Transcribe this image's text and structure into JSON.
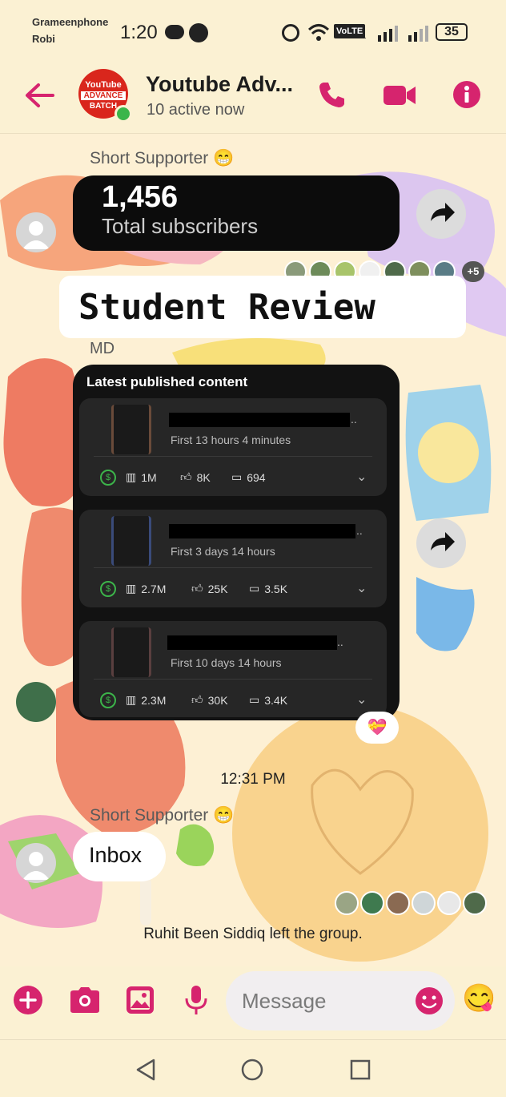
{
  "status_bar": {
    "carrier_1": "Grameenphone",
    "carrier_2": "Robi",
    "time": "1:20",
    "volte": "VoLTE",
    "sim_index": "1",
    "battery": "35"
  },
  "header": {
    "title": "Youtube Adv...",
    "subtitle": "10 active now",
    "logo_line_1": "YouTube",
    "logo_line_2": "ADVANCE",
    "logo_line_3": "BATCH"
  },
  "messages": [
    {
      "sender": "Short Supporter 😁",
      "subscriber_count": "1,456",
      "subscriber_label": "Total subscribers"
    },
    {
      "review_label": "Student Review"
    },
    {
      "sender": "MD",
      "panel_title": "Latest published content",
      "videos": [
        {
          "caption": "First 13 hours 4 minutes",
          "views": "1M",
          "likes": "8K",
          "comments": "694",
          "title_ellipsis": ".."
        },
        {
          "caption": "First 3 days 14 hours",
          "views": "2.7M",
          "likes": "25K",
          "comments": "3.5K",
          "title_ellipsis": ".."
        },
        {
          "caption": "First 10 days 14 hours",
          "views": "2.3M",
          "likes": "30K",
          "comments": "3.4K",
          "title_ellipsis": ".."
        }
      ],
      "reaction": "💝"
    },
    {
      "timestamp": "12:31 PM"
    },
    {
      "sender": "Short Supporter 😁",
      "text": "Inbox"
    },
    {
      "system": "Ruhit Been Siddiq left the group."
    }
  ],
  "read_receipts_more": "+5",
  "composer": {
    "placeholder": "Message",
    "emoji_button": "😋"
  },
  "colors": {
    "accent": "#d6246e",
    "background": "#fdf0d4",
    "dark_bubble": "#0c0c0c"
  }
}
